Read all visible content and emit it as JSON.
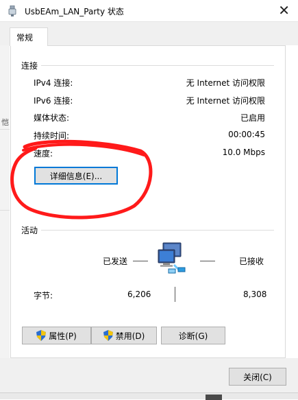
{
  "window": {
    "title": "UsbEAm_LAN_Party 状态",
    "close_glyph": "✕"
  },
  "tabs": [
    {
      "label": "常规"
    }
  ],
  "behind_mark": "恺",
  "connection": {
    "group_label": "连接",
    "rows": [
      {
        "label": "IPv4 连接:",
        "value": "无 Internet 访问权限"
      },
      {
        "label": "IPv6 连接:",
        "value": "无 Internet 访问权限"
      },
      {
        "label": "媒体状态:",
        "value": "已启用"
      },
      {
        "label": "持续时间:",
        "value": "00:00:45"
      },
      {
        "label": "速度:",
        "value": "10.0 Mbps"
      }
    ],
    "details_button": "详细信息(E)..."
  },
  "activity": {
    "group_label": "活动",
    "sent_label": "已发送",
    "received_label": "已接收",
    "bytes_label": "字节:",
    "bytes_sent": "6,206",
    "bytes_received": "8,308"
  },
  "buttons": {
    "properties": "属性(P)",
    "disable": "禁用(D)",
    "diagnose": "诊断(G)",
    "close": "关闭(C)"
  },
  "colors": {
    "annotation_red": "#ff1a1a",
    "accent": "#0078d7",
    "shield_blue": "#2b6ed0",
    "shield_yellow": "#f2c40f"
  }
}
